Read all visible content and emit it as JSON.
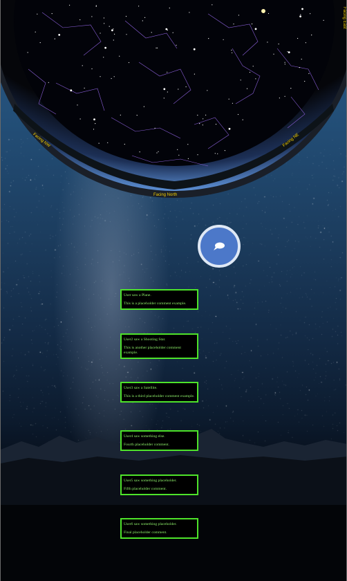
{
  "skymap": {
    "facing_north": "Facing North",
    "facing_nw": "Facing NW",
    "facing_ne": "Facing NE",
    "facing_east": "Facing East"
  },
  "chat_button": {
    "icon": "speech-bubble-icon"
  },
  "comments": [
    {
      "title": "User saw a Plane.",
      "body": "This is a placeholder comment example."
    },
    {
      "title": "User2 saw a Shooting Star.",
      "body": "This is another placeholder comment example."
    },
    {
      "title": "User3 saw a Satellite.",
      "body": "This is a third placeholder comment example."
    },
    {
      "title": "User4 saw something else.",
      "body": "Fourth placeholder comment."
    },
    {
      "title": "User5 saw something placeholder.",
      "body": "Fifth placeholder comment."
    },
    {
      "title": "User6 saw something placeholder.",
      "body": "Final placeholder comment."
    }
  ],
  "colors": {
    "comment_border": "#4ee32a",
    "comment_text": "#8ef06a",
    "facing_label": "#f5d000",
    "chat_button": "#4c78c9"
  }
}
